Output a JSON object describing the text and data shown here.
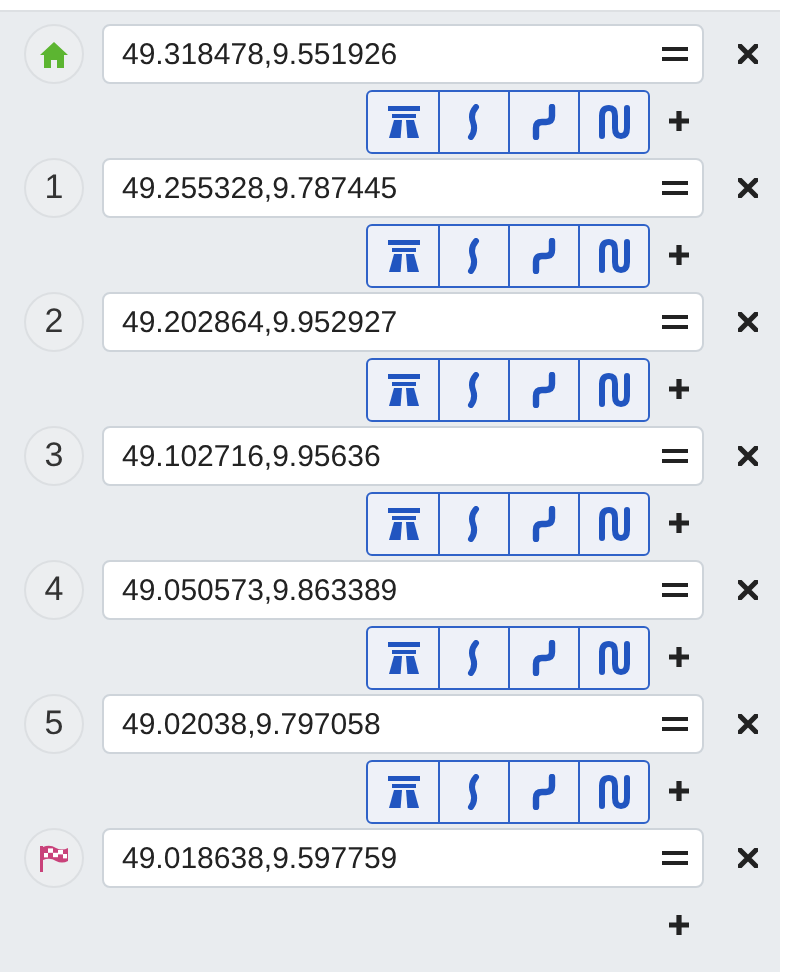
{
  "waypoints": [
    {
      "kind": "home",
      "value": "49.318478,9.551926"
    },
    {
      "kind": "number",
      "label": "1",
      "value": "49.255328,9.787445"
    },
    {
      "kind": "number",
      "label": "2",
      "value": "49.202864,9.952927"
    },
    {
      "kind": "number",
      "label": "3",
      "value": "49.102716,9.95636"
    },
    {
      "kind": "number",
      "label": "4",
      "value": "49.050573,9.863389"
    },
    {
      "kind": "number",
      "label": "5",
      "value": "49.02038,9.797058"
    },
    {
      "kind": "finish",
      "value": "49.018638,9.597759"
    }
  ]
}
